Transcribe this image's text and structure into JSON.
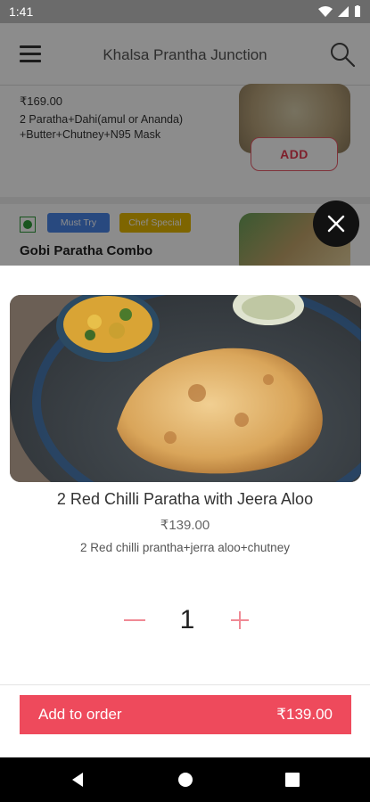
{
  "status_bar": {
    "time": "1:41"
  },
  "app_bar": {
    "title": "Khalsa Prantha Junction"
  },
  "menu_items": [
    {
      "price": "₹169.00",
      "description": "2 Paratha+Dahi(amul or Ananda) +Butter+Chutney+N95 Mask",
      "add_label": "ADD"
    },
    {
      "tags": [
        "Must Try",
        "Chef Special"
      ],
      "title": "Gobi Paratha Combo"
    }
  ],
  "dish": {
    "title": "2 Red Chilli Paratha with Jeera Aloo",
    "price": "₹139.00",
    "description": "2 Red chilli prantha+jerra aloo+chutney"
  },
  "quantity": {
    "value": "1"
  },
  "order": {
    "label": "Add to order",
    "total": "₹139.00"
  },
  "colors": {
    "accent": "#ee4a5c",
    "veg_green": "#2e9b3a",
    "tag_must_try": "#4a86e8",
    "tag_chef_special": "#e6b800"
  },
  "icons": [
    "menu-icon",
    "search-icon",
    "close-icon",
    "minus-icon",
    "plus-icon",
    "veg-icon",
    "back-icon",
    "home-icon",
    "recents-icon"
  ]
}
